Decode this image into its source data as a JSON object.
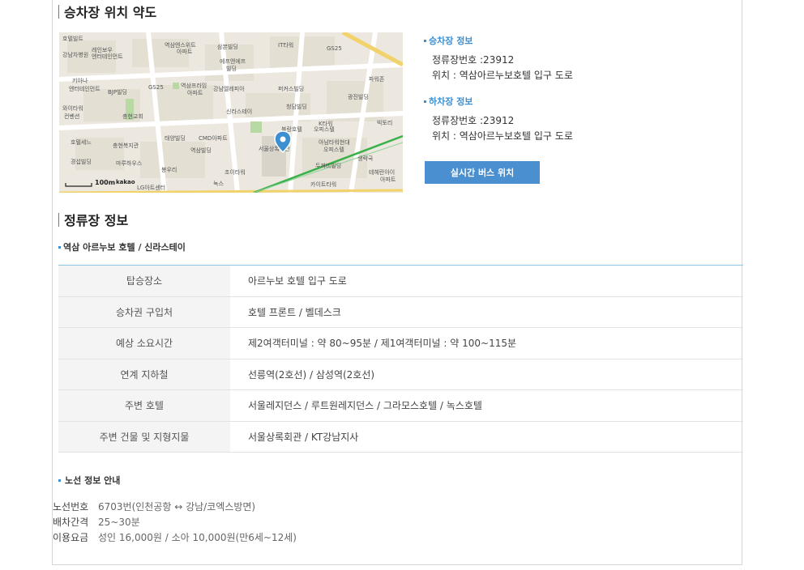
{
  "section1": {
    "title": "승차장 위치 약도"
  },
  "map": {
    "scale_label": "100m",
    "brand": "kakao",
    "labels": [
      "호텔빌트",
      "레인보우",
      "역삼엔스위트",
      "삼본빌딩",
      "IT타워",
      "GS25",
      "강남차병원",
      "엔터테인먼트",
      "아파트",
      "에프앤에프",
      "빌딩",
      "파워존",
      "키아나",
      "엔터테인먼트",
      "BJP빌딩",
      "GS25",
      "역삼프라임",
      "아파트",
      "강남엘레피아",
      "퍼커스빌딩",
      "광진빌딩",
      "와이타워",
      "컨벤션",
      "충현교회",
      "신라스테이",
      "청담빌딩",
      "K타워",
      "블랑호텔",
      "오피스텔",
      "빅토리",
      "호텔세느",
      "충현복지관",
      "태양빌딩",
      "CMD아파트",
      "아남타워현대",
      "오피스텔",
      "역삼빌딩",
      "경섭빌딩",
      "마루하우스",
      "봉우리",
      "조이타워",
      "두꺼비빌딩",
      "테헤란아이",
      "아파트",
      "LG아트센터",
      "녹스",
      "카이트타워",
      "서울상록회관",
      "생략국"
    ]
  },
  "boarding": {
    "title": "승차장 정보",
    "stop_no": "정류장번호 :23912",
    "location": "위치 : 역삼아르누보호텔 입구 도로"
  },
  "alighting": {
    "title": "하차장 정보",
    "stop_no": "정류장번호 :23912",
    "location": "위치 : 역삼아르누보호텔 입구 도로"
  },
  "realtime_button": "실시간 버스 위치",
  "section2": {
    "title": "정류장 정보",
    "subtitle": "역삼 아르누보 호텔 / 신라스테이"
  },
  "stop_table": [
    {
      "key": "탑승장소",
      "value": "아르누보 호텔 입구 도로"
    },
    {
      "key": "승차권 구입처",
      "value": "호텔 프론트 / 벨데스크"
    },
    {
      "key": "예상 소요시간",
      "value": "제2여객터미널 : 약 80~95분 / 제1여객터미널 : 약 100~115분"
    },
    {
      "key": "연계 지하철",
      "value": "선릉역(2호선) / 삼성역(2호선)"
    },
    {
      "key": "주변 호텔",
      "value": "서울레지던스 / 루트원레지던스 / 그라모스호텔 / 녹스호텔"
    },
    {
      "key": "주변 건물 및 지형지물",
      "value": "서울상록회관 / KT강남지사"
    }
  ],
  "route": {
    "title": "노선 정보 안내",
    "rows": [
      {
        "key": "노선번호",
        "value": "6703번(인천공항 ↔ 강남/코엑스방면)"
      },
      {
        "key": "배차간격",
        "value": "25~30분"
      },
      {
        "key": "이용요금",
        "value": "성인 16,000원 / 소아 10,000원(만6세~12세)"
      }
    ]
  },
  "colors": {
    "accent": "#3d8fd0",
    "button": "#4a8fd0",
    "table_line": "#8ec6e6"
  }
}
